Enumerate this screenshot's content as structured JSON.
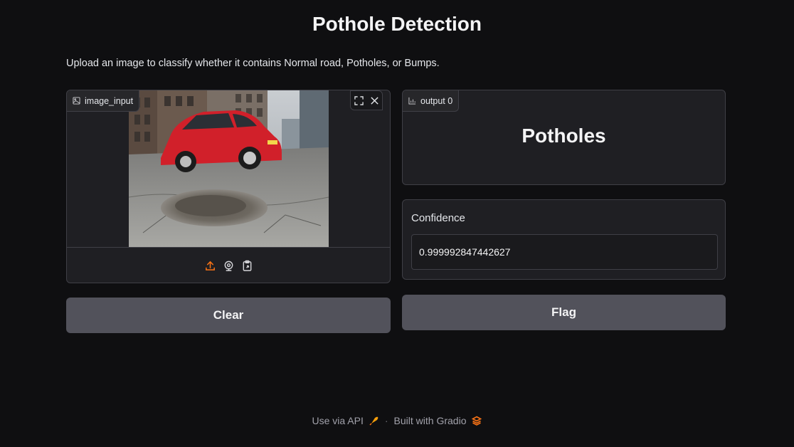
{
  "header": {
    "title": "Pothole Detection",
    "description": "Upload an image to classify whether it contains Normal road, Potholes, or Bumps."
  },
  "input_panel": {
    "label": "image_input",
    "label_icon": "image-icon",
    "toolbar_icons": [
      "fullscreen-icon",
      "close-icon"
    ],
    "source_icons": [
      "upload-icon",
      "webcam-icon",
      "clipboard-icon"
    ]
  },
  "output_panel": {
    "label": "output 0",
    "label_icon": "bar-chart-icon",
    "value": "Potholes"
  },
  "confidence": {
    "label": "Confidence",
    "value": "0.999992847442627"
  },
  "buttons": {
    "clear": "Clear",
    "flag": "Flag"
  },
  "footer": {
    "api_link": "Use via API",
    "separator": "·",
    "built_with": "Built with Gradio"
  },
  "colors": {
    "background": "#0f0f11",
    "panel": "#1f1f23",
    "button": "#52525b",
    "accent": "#f97316"
  }
}
